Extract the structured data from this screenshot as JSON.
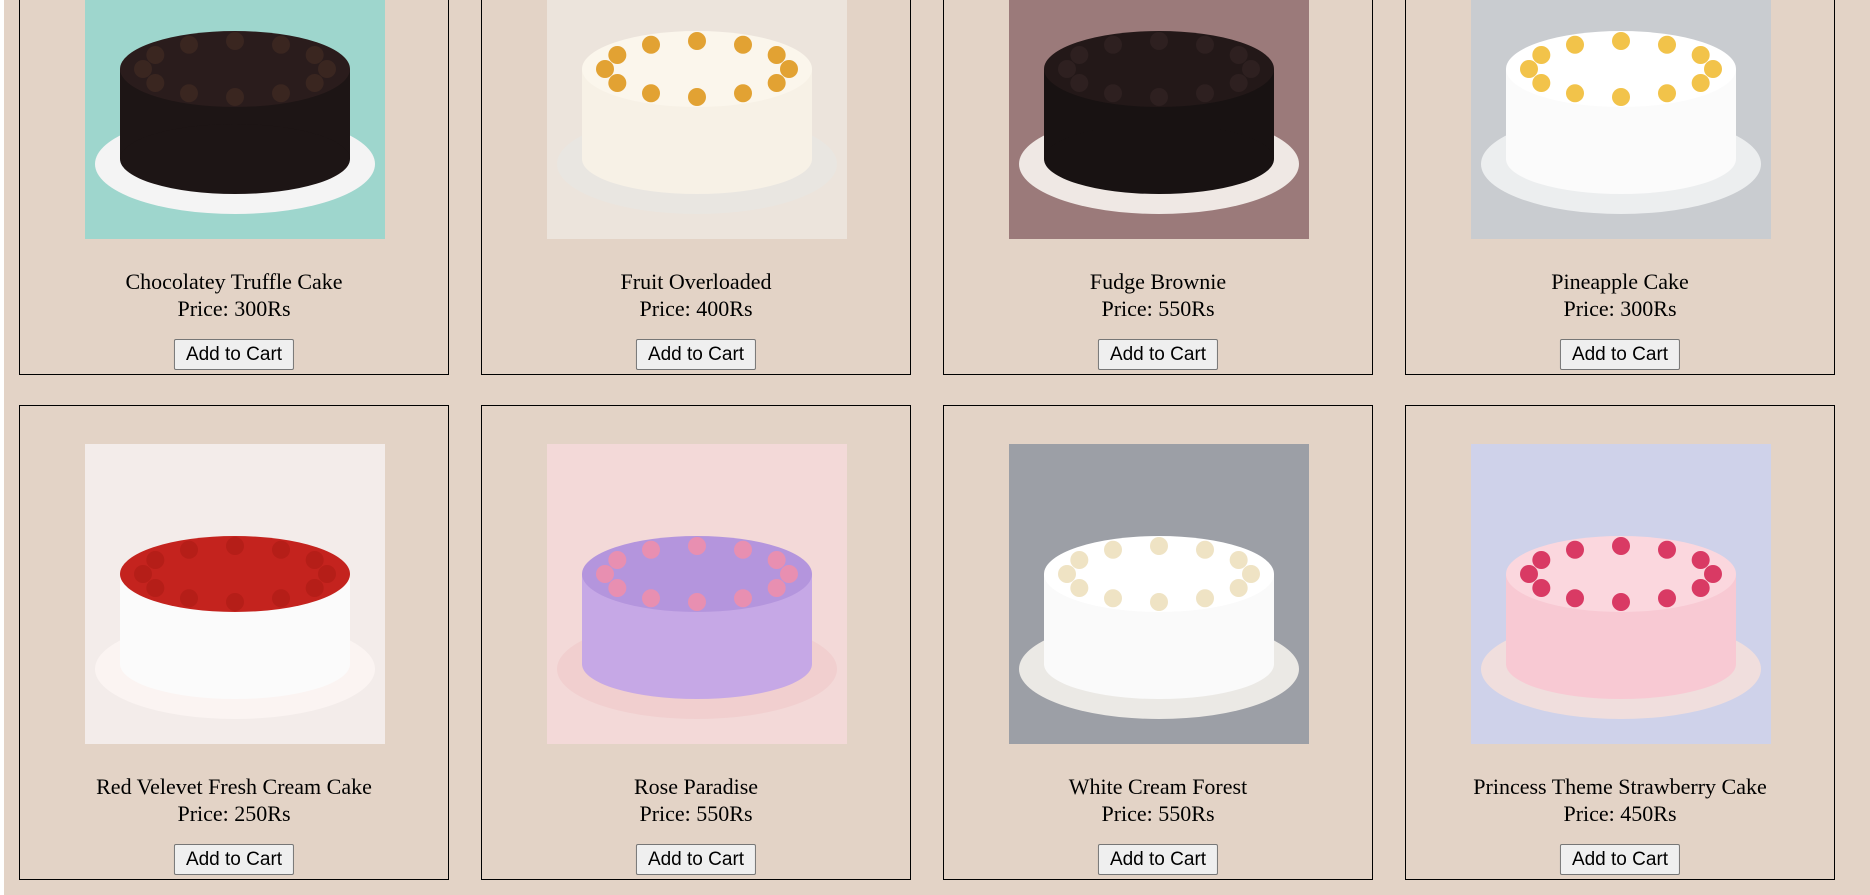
{
  "products": [
    {
      "name": "Chocolatey Truffle Cake",
      "price": "Price: 300Rs",
      "button": "Add to Cart",
      "image": "chocolate-truffle-cake-image",
      "colors": {
        "bg": "#9ed6cd",
        "plate": "#f4f4f4",
        "cake": "#1d1515",
        "top": "#2a1c1c",
        "deco": "#3a2620"
      }
    },
    {
      "name": "Fruit Overloaded",
      "price": "Price: 400Rs",
      "button": "Add to Cart",
      "image": "fruit-overloaded-cake-image",
      "colors": {
        "bg": "#ece4dc",
        "plate": "#e9e6e1",
        "cake": "#f7f1e6",
        "top": "#fbf6ec",
        "deco": "#e2a233"
      }
    },
    {
      "name": "Fudge Brownie",
      "price": "Price: 550Rs",
      "button": "Add to Cart",
      "image": "fudge-brownie-cake-image",
      "colors": {
        "bg": "#9b7a7a",
        "plate": "#efe8e4",
        "cake": "#181212",
        "top": "#231818",
        "deco": "#2e2020"
      }
    },
    {
      "name": "Pineapple Cake",
      "price": "Price: 300Rs",
      "button": "Add to Cart",
      "image": "pineapple-cake-image",
      "colors": {
        "bg": "#c9ccd0",
        "plate": "#eceeef",
        "cake": "#fbfbfb",
        "top": "#ffffff",
        "deco": "#f2c34a"
      }
    },
    {
      "name": "Red Velevet Fresh Cream Cake",
      "price": "Price: 250Rs",
      "button": "Add to Cart",
      "image": "red-velvet-cake-image",
      "colors": {
        "bg": "#f3ecea",
        "plate": "#fbf4f2",
        "cake": "#fbfbfb",
        "top": "#c4231e",
        "deco": "#b51e18"
      }
    },
    {
      "name": "Rose Paradise",
      "price": "Price: 550Rs",
      "button": "Add to Cart",
      "image": "rose-paradise-cake-image",
      "colors": {
        "bg": "#f3d9d8",
        "plate": "#f1cfcf",
        "cake": "#c6a8e6",
        "top": "#b495dd",
        "deco": "#e88fb1"
      }
    },
    {
      "name": "White Cream Forest",
      "price": "Price: 550Rs",
      "button": "Add to Cart",
      "image": "white-cream-forest-cake-image",
      "colors": {
        "bg": "#9c9fa6",
        "plate": "#ebe9e5",
        "cake": "#fafafa",
        "top": "#ffffff",
        "deco": "#efe3c4"
      }
    },
    {
      "name": "Princess Theme Strawberry Cake",
      "price": "Price: 450Rs",
      "button": "Add to Cart",
      "image": "princess-strawberry-cake-image",
      "colors": {
        "bg": "#cfd2ea",
        "plate": "#f0dedd",
        "cake": "#f8c9d3",
        "top": "#fbd7de",
        "deco": "#d93a64"
      }
    }
  ]
}
